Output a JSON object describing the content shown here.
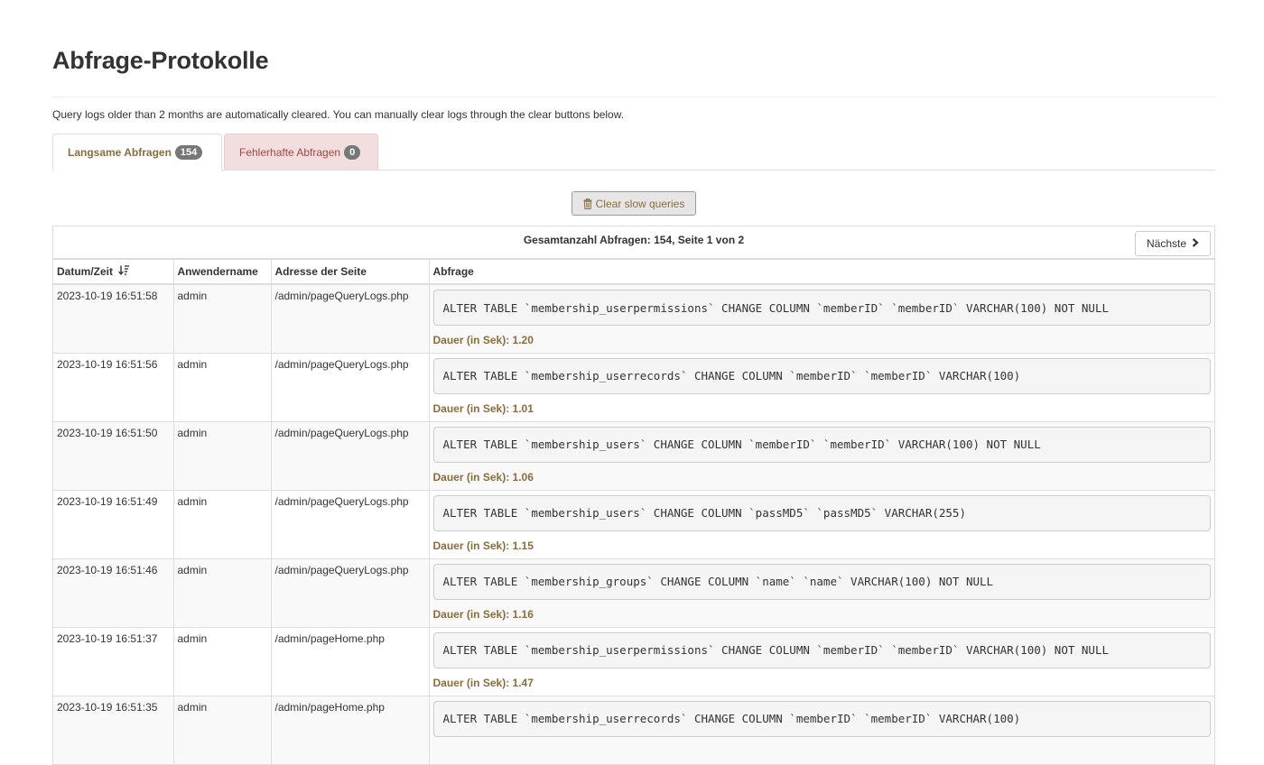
{
  "page": {
    "title": "Abfrage-Protokolle",
    "notice": "Query logs older than 2 months are automatically cleared. You can manually clear logs through the clear buttons below."
  },
  "tabs": [
    {
      "label": "Langsame Abfragen",
      "badge": "154",
      "active": true
    },
    {
      "label": "Fehlerhafte Abfragen",
      "badge": "0",
      "active": false
    }
  ],
  "clear_button": {
    "label": "Clear slow queries",
    "icon": "trash-icon"
  },
  "table": {
    "caption": "Gesamtanzahl Abfragen: 154, Seite 1 von 2",
    "next_label": "Nächste",
    "headers": [
      "Datum/Zeit",
      "Anwendername",
      "Adresse der Seite",
      "Abfrage"
    ],
    "duration_prefix": "Dauer (in Sek):",
    "rows": [
      {
        "datetime": "2023-10-19 16:51:58",
        "user": "admin",
        "page": "/admin/pageQueryLogs.php",
        "query": "ALTER TABLE `membership_userpermissions` CHANGE COLUMN `memberID` `memberID` VARCHAR(100) NOT NULL",
        "duration": "Dauer (in Sek): 1.20"
      },
      {
        "datetime": "2023-10-19 16:51:56",
        "user": "admin",
        "page": "/admin/pageQueryLogs.php",
        "query": "ALTER TABLE `membership_userrecords` CHANGE COLUMN `memberID` `memberID` VARCHAR(100)",
        "duration": "Dauer (in Sek): 1.01"
      },
      {
        "datetime": "2023-10-19 16:51:50",
        "user": "admin",
        "page": "/admin/pageQueryLogs.php",
        "query": "ALTER TABLE `membership_users` CHANGE COLUMN `memberID` `memberID` VARCHAR(100) NOT NULL",
        "duration": "Dauer (in Sek): 1.06"
      },
      {
        "datetime": "2023-10-19 16:51:49",
        "user": "admin",
        "page": "/admin/pageQueryLogs.php",
        "query": "ALTER TABLE `membership_users` CHANGE COLUMN `passMD5` `passMD5` VARCHAR(255)",
        "duration": "Dauer (in Sek): 1.15"
      },
      {
        "datetime": "2023-10-19 16:51:46",
        "user": "admin",
        "page": "/admin/pageQueryLogs.php",
        "query": "ALTER TABLE `membership_groups` CHANGE COLUMN `name` `name` VARCHAR(100) NOT NULL",
        "duration": "Dauer (in Sek): 1.16"
      },
      {
        "datetime": "2023-10-19 16:51:37",
        "user": "admin",
        "page": "/admin/pageHome.php",
        "query": "ALTER TABLE `membership_userpermissions` CHANGE COLUMN `memberID` `memberID` VARCHAR(100) NOT NULL",
        "duration": "Dauer (in Sek): 1.47"
      },
      {
        "datetime": "2023-10-19 16:51:35",
        "user": "admin",
        "page": "/admin/pageHome.php",
        "query": "ALTER TABLE `membership_userrecords` CHANGE COLUMN `memberID` `memberID` VARCHAR(100)",
        "duration": ""
      }
    ]
  },
  "colors": {
    "warning_text": "#8a6d3b",
    "danger_text": "#a94442",
    "danger_bg": "#f2dede",
    "badge_bg": "#777777"
  }
}
